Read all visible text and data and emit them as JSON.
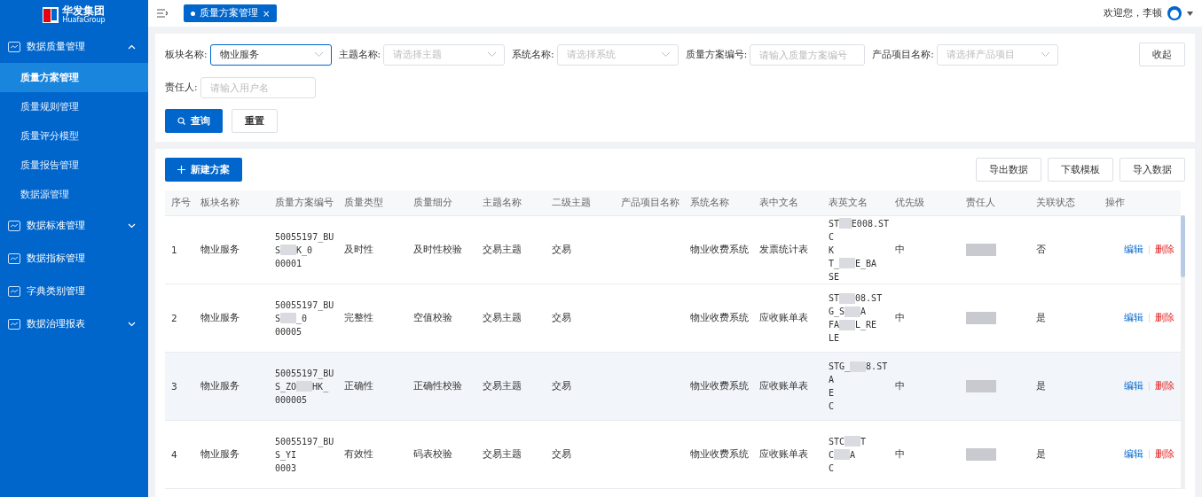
{
  "logo": {
    "name": "华发集团",
    "sub": "HuafaGroup"
  },
  "sidebar": {
    "items": [
      {
        "label": "数据质量管理",
        "expanded": true,
        "children": [
          {
            "label": "质量方案管理",
            "selected": true
          },
          {
            "label": "质量规则管理",
            "selected": false
          },
          {
            "label": "质量评分模型",
            "selected": false
          },
          {
            "label": "质量报告管理",
            "selected": false
          },
          {
            "label": "数据源管理",
            "selected": false
          }
        ]
      },
      {
        "label": "数据标准管理",
        "expanded": false,
        "has_caret": true
      },
      {
        "label": "数据指标管理",
        "expanded": false,
        "has_caret": false
      },
      {
        "label": "字典类别管理",
        "expanded": false,
        "has_caret": false
      },
      {
        "label": "数据治理报表",
        "expanded": false,
        "has_caret": true
      }
    ]
  },
  "tabs": [
    {
      "label": "质量方案管理",
      "selected": true,
      "close": "×"
    }
  ],
  "user": {
    "greeting": "欢迎您，李顿"
  },
  "filters": [
    {
      "kind": "select",
      "label": "板块名称:",
      "value": "物业服务",
      "focused": true
    },
    {
      "kind": "select",
      "label": "主题名称:",
      "placeholder": "请选择主题",
      "focused": false
    },
    {
      "kind": "select",
      "label": "系统名称:",
      "placeholder": "请选择系统",
      "focused": false
    },
    {
      "kind": "input",
      "label": "质量方案编号:",
      "placeholder": "请输入质量方案编号",
      "focused": false
    },
    {
      "kind": "select",
      "label": "产品项目名称:",
      "placeholder": "请选择产品项目",
      "focused": false
    },
    {
      "kind": "input",
      "label": "责任人:",
      "placeholder": "请输入用户名",
      "focused": false
    }
  ],
  "collapse_button": "收起",
  "query_button": "查询",
  "reset_button": "重置",
  "new_button": "新建方案",
  "toolbar_buttons": [
    "导出数据",
    "下载模板",
    "导入数据"
  ],
  "table": {
    "columns": [
      "序号",
      "板块名称",
      "质量方案编号",
      "质量类型",
      "质量细分",
      "主题名称",
      "二级主题",
      "产品项目名称",
      "系统名称",
      "表中文名",
      "表英文名",
      "优先级",
      "责任人",
      "关联状态",
      "操作"
    ],
    "rows": [
      {
        "index": "1",
        "segment": "物业服务",
        "code_lines": [
          [
            "50055197_BU"
          ],
          [
            "S",
            "K_0"
          ],
          [
            "00001"
          ]
        ],
        "quality_type": "及时性",
        "quality_sub": "及时性校验",
        "topic": "交易主题",
        "sub_topic": "交易",
        "system": "物业收费系统",
        "table_cn": "发票统计表",
        "en_lines": [
          [
            "ST",
            "E008.ST"
          ],
          [
            "C"
          ],
          [
            "K"
          ],
          [
            "T_",
            "E_BA"
          ],
          [
            "SE"
          ]
        ],
        "priority": "中",
        "status": "否",
        "highlighted": false,
        "actions": [
          "编辑",
          "删除"
        ]
      },
      {
        "index": "2",
        "segment": "物业服务",
        "code_lines": [
          [
            "50055197_BU"
          ],
          [
            "S",
            "_0"
          ],
          [
            "00005"
          ]
        ],
        "quality_type": "完整性",
        "quality_sub": "空值校验",
        "topic": "交易主题",
        "sub_topic": "交易",
        "system": "物业收费系统",
        "table_cn": "应收账单表",
        "en_lines": [
          [
            "ST",
            "08.ST"
          ],
          [
            "G_S",
            "A"
          ],
          [
            "FA",
            "L_RE"
          ],
          [
            "LE"
          ]
        ],
        "priority": "中",
        "status": "是",
        "highlighted": false,
        "actions": [
          "编辑",
          "删除"
        ]
      },
      {
        "index": "3",
        "segment": "物业服务",
        "code_lines": [
          [
            "50055197_BU"
          ],
          [
            "S_ZO",
            "HK_"
          ],
          [
            "000005"
          ]
        ],
        "quality_type": "正确性",
        "quality_sub": "正确性校验",
        "topic": "交易主题",
        "sub_topic": "交易",
        "system": "物业收费系统",
        "table_cn": "应收账单表",
        "en_lines": [
          [
            "STG_",
            "8.ST"
          ],
          [
            "A"
          ],
          [
            "E"
          ],
          [
            "C"
          ]
        ],
        "priority": "中",
        "status": "是",
        "highlighted": true,
        "actions": [
          "编辑",
          "删除"
        ]
      },
      {
        "index": "4",
        "segment": "物业服务",
        "code_lines": [
          [
            "50055197_BU"
          ],
          [
            "S_YI"
          ],
          [
            "0003"
          ]
        ],
        "quality_type": "有效性",
        "quality_sub": "码表校验",
        "topic": "交易主题",
        "sub_topic": "交易",
        "system": "物业收费系统",
        "table_cn": "应收账单表",
        "en_lines": [
          [
            "STC",
            "T"
          ],
          [
            "C",
            "A"
          ],
          [
            "C"
          ]
        ],
        "priority": "中",
        "status": "是",
        "highlighted": false,
        "actions": [
          "编辑",
          "删除"
        ]
      }
    ]
  }
}
